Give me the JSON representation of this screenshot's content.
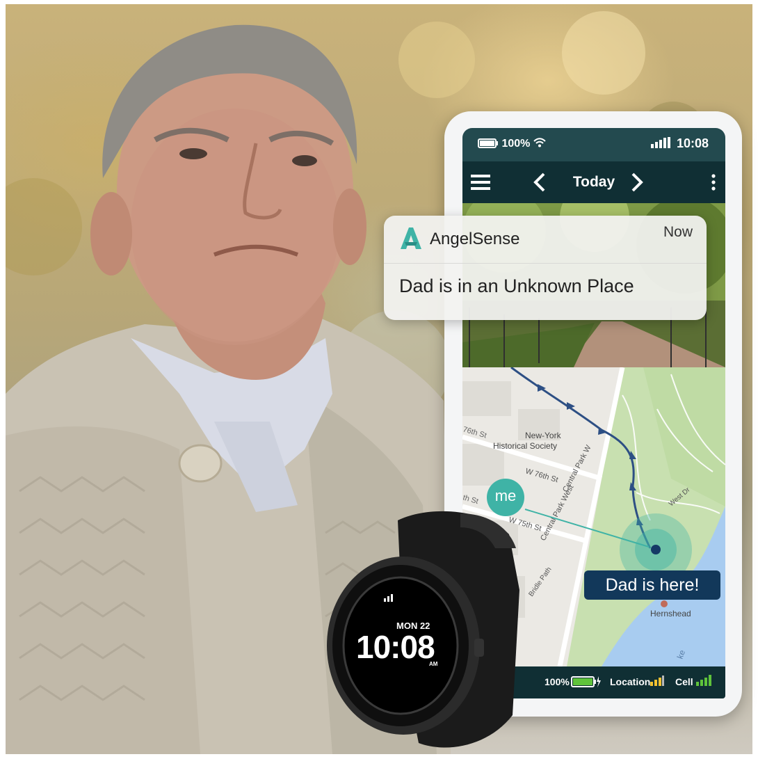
{
  "phone": {
    "status_battery": "100%",
    "status_time": "10:08",
    "nav_title": "Today",
    "bottom_battery": "100%",
    "bottom_location": "Location",
    "bottom_cell": "Cell"
  },
  "notification": {
    "app_name": "AngelSense",
    "time": "Now",
    "message": "Dad is in an Unknown Place"
  },
  "map": {
    "me_label": "me",
    "here_label": "Dad is here!",
    "places": {
      "society_line1": "New-York",
      "society_line2": "Historical Society",
      "hernshead": "Hernshead"
    },
    "streets": {
      "w76": "W 76th St",
      "w75": "W 75th St",
      "st76": "76th St",
      "st75": "th St",
      "cpw_left": "Central Park West",
      "cpw_right": "Central Park W",
      "bridle": "Bridle Path",
      "west_dr": "West Dr",
      "ke": "ke"
    }
  },
  "watch": {
    "date": "MON 22",
    "time": "10:08",
    "ampm": "AM"
  },
  "colors": {
    "app_header": "#102f34",
    "status_bar": "#234a4f",
    "accent_teal": "#3fb3a6",
    "here_label_bg": "#12385a"
  }
}
